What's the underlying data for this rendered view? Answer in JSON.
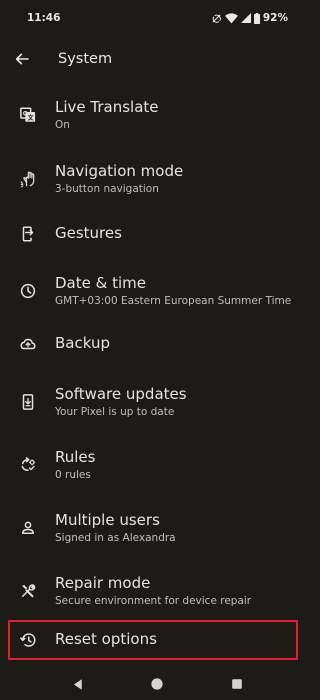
{
  "status_bar": {
    "time": "11:46",
    "battery": "92%",
    "icons": [
      "do-not-disturb-icon",
      "wifi-icon",
      "signal-icon",
      "battery-icon"
    ]
  },
  "app_bar": {
    "title": "System",
    "back_icon": "arrow-back-icon"
  },
  "items": [
    {
      "title": "Live Translate",
      "subtitle": "On",
      "icon": "translate-icon"
    },
    {
      "title": "Navigation mode",
      "subtitle": "3-button navigation",
      "icon": "gesture-hand-icon"
    },
    {
      "title": "Gestures",
      "subtitle": "",
      "icon": "phone-gesture-icon"
    },
    {
      "title": "Date & time",
      "subtitle": "GMT+03:00 Eastern European Summer Time",
      "icon": "clock-icon"
    },
    {
      "title": "Backup",
      "subtitle": "",
      "icon": "cloud-upload-icon"
    },
    {
      "title": "Software updates",
      "subtitle": "Your Pixel is up to date",
      "icon": "system-update-icon"
    },
    {
      "title": "Rules",
      "subtitle": "0 rules",
      "icon": "rules-icon"
    },
    {
      "title": "Multiple users",
      "subtitle": "Signed in as Alexandra",
      "icon": "person-icon"
    },
    {
      "title": "Repair mode",
      "subtitle": "Secure environment for device repair",
      "icon": "repair-tools-icon"
    },
    {
      "title": "Reset options",
      "subtitle": "",
      "icon": "history-icon"
    }
  ],
  "highlight_color": "#e0222e",
  "nav_bar": {
    "buttons": [
      "back-triangle-icon",
      "home-circle-icon",
      "recents-square-icon"
    ]
  }
}
